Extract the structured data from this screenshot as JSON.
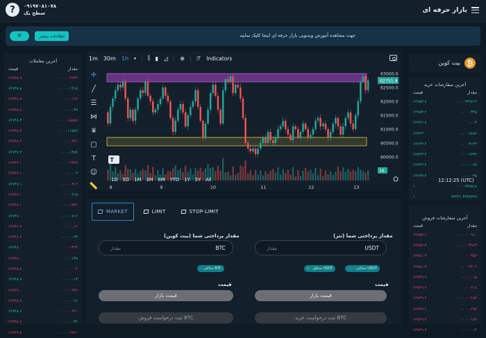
{
  "header": {
    "brand": "بازار حرفه ای",
    "phone": "۰۹۱۹۷۰۸۱۰۷۸",
    "level": "سطح یک",
    "help_glyph": "?"
  },
  "banner": {
    "text": "جهت مشاهده آموزش ویدیویی بازار حرفه ای اینجا کلیک نمایید",
    "more_label": "اطلاعات بیشتر",
    "close_glyph": "✕"
  },
  "ticker": {
    "name": "بیت کوین",
    "symbol_glyph": "₿"
  },
  "colors": {
    "accent": "#13c4c0",
    "buy": "#21c47a",
    "sell": "#e0455b",
    "bg": "#0e1a24",
    "panel": "#131f2b"
  },
  "chart_toolbar": {
    "intervals": [
      "1m",
      "30m",
      "1h"
    ],
    "active_interval": "1h",
    "indicators_label": "Indicators"
  },
  "chart_data": {
    "type": "candlestick",
    "x_ticks": [
      "8",
      "9",
      "10",
      "11",
      "12",
      "13"
    ],
    "y_ticks": [
      "63000.0",
      "62500.0",
      "62000.0",
      "61500.0",
      "61000.0",
      "60500.0",
      "60000.0"
    ],
    "ylim": [
      59700,
      63100
    ],
    "last_price": "62751.9",
    "volume_label": "16",
    "close_series": [
      61600,
      61200,
      61800,
      62100,
      62400,
      62600,
      62500,
      62700,
      62100,
      61400,
      61700,
      61300,
      61700,
      62100,
      62400,
      62300,
      62700,
      62200,
      62000,
      61600,
      61700,
      61900,
      62100,
      62500,
      62200,
      62000,
      61400,
      60900,
      61300,
      61700,
      61900,
      61600,
      61100,
      61500,
      61800,
      62000,
      62400,
      61800,
      61300,
      60700,
      61200,
      61700,
      62300,
      62600,
      62200,
      61700,
      61200,
      62400,
      62800,
      62700,
      62900,
      62300,
      62600,
      62500,
      62100,
      61400,
      60500,
      60300,
      60200,
      60300,
      60100,
      60300,
      60500,
      60700,
      60500,
      60900,
      60600,
      60500,
      60700,
      61000,
      61100,
      61300,
      61000,
      60800,
      60600,
      61100,
      61000,
      60700,
      60900,
      61200,
      61000,
      60700,
      60800,
      61000,
      61300,
      61400,
      61100,
      61200,
      61000,
      60700,
      60900,
      61200,
      61400,
      61100,
      60800,
      61100,
      61400,
      61600,
      61200,
      61000,
      61500,
      62000,
      62700,
      62900,
      62400,
      62751.9
    ],
    "zones": [
      {
        "name": "resistance",
        "low": 62700,
        "high": 63000
      },
      {
        "name": "support",
        "low": 60400,
        "high": 60700
      }
    ]
  },
  "ranges": [
    "1D",
    "5D",
    "1M",
    "3M",
    "6M",
    "YTD",
    "1Y",
    "5Y",
    "All"
  ],
  "clock": "12:12:25 (UTC)",
  "trades": {
    "title": "آخرین معاملات",
    "col_amount": "مقدار",
    "col_price": "قیمت",
    "rows": [
      {
        "amount": "۰.۰۰۰۰۴۲۳۲",
        "price": "۶۲۷۴۸.۹",
        "side": "sell"
      },
      {
        "amount": "۰.۰۰۰۰۱۴۱۸",
        "price": "۶۲۷۴۸.۸",
        "side": "buy"
      },
      {
        "amount": "۰.۰۰۰۱۶۷",
        "price": "۶۲۷۴۸.۷",
        "side": "buy"
      },
      {
        "amount": "۰.۰۰۰۰۳۹",
        "price": "۶۲۷۴۸.۶",
        "side": "buy"
      },
      {
        "amount": "۰.۰۰۰۱۵۸۸۷",
        "price": "۶۲۷۴۸.۳",
        "side": "buy"
      },
      {
        "amount": "۰.۰۰۰۱۱۵۸۹",
        "price": "۶۲۷۴۸.۳",
        "side": "buy"
      },
      {
        "amount": "۰.۰۰۰۴۳۱",
        "price": "۶۲۷۴۸.۲",
        "side": "buy"
      },
      {
        "amount": "۰.۰۰۰۱۴۵۹",
        "price": "۶۲۷۴۷.۳",
        "side": "buy"
      },
      {
        "amount": "۰.۰۰۰۰۶۳۷۹",
        "price": "۶۲۷۴۷.۱",
        "side": "buy"
      },
      {
        "amount": "۰.۰۰۰۳",
        "price": "۶۲۷۴۷.۱",
        "side": "buy"
      },
      {
        "amount": "۰.۰۰۰۰۳۱۲",
        "price": "۶۲۷۴۷.۱",
        "side": "buy"
      },
      {
        "amount": "۰.۰۰۰۲۱۵",
        "price": "۶۲۷۴۷.۱",
        "side": "buy"
      },
      {
        "amount": "۰.۰۰۰۰۱۳۴۲",
        "price": "۶۲۷۴۷.۱",
        "side": "buy"
      },
      {
        "amount": "۰.۰۰۰۰۷۱۲",
        "price": "۶۲۷۴۷.۰",
        "side": "buy"
      },
      {
        "amount": "۰.۰۰۰۰۱۴",
        "price": "۶۲۷۴۶.۹",
        "side": "buy"
      },
      {
        "amount": "۰.۰۰۰۰۰۹۴",
        "price": "۶۲۷۴۶.۶",
        "side": "buy"
      },
      {
        "amount": "۰.۰۰۰۱۳۲۳",
        "price": "۶۲۷۴۸.۰",
        "side": "buy"
      },
      {
        "amount": "۰.۰۰۰۱۳۸",
        "price": "۶۲۷۴۸.۰",
        "side": "buy"
      },
      {
        "amount": "۰.۰۰۰۴",
        "price": "۶۲۷۴۸.۸",
        "side": "buy"
      },
      {
        "amount": "۰.۰۰۰۰۱۳",
        "price": "۶۲۷۴۸.۹",
        "side": "buy"
      },
      {
        "amount": "۰.۰۰۰۰۲۴۲",
        "price": "۶۲۷۴۹.۰",
        "side": "buy"
      },
      {
        "amount": "۰.۰۰۰۰۱۲",
        "price": "۶۲۷۴۸.۹",
        "side": "buy"
      },
      {
        "amount": "۰.۰۰۰۰۳۲۱",
        "price": "۶۲۷۴۸.۶",
        "side": "buy"
      },
      {
        "amount": "۰.۰۰۰۰۳۲",
        "price": "۶۲۷۴۸.۶",
        "side": "buy"
      },
      {
        "amount": "۰.۰۰۰۰۲۳۲۱",
        "price": "۶۲۷۴۹.۹",
        "side": "buy"
      }
    ]
  },
  "buy_orders": {
    "title": "آخرین سفارشات خرید",
    "col_amount": "مقدار",
    "col_price": "قیمت",
    "rows": [
      {
        "amount": "۰.۰۰۲۳۹۷۱۴",
        "price": "۶۲۷۵۳.۸"
      },
      {
        "amount": "۰.۰۰۰۰۳۴۵",
        "price": "۶۲۷۵۳.۲"
      },
      {
        "amount": "۰.۰۰۴",
        "price": "۶۲۷۴۶.۸"
      },
      {
        "amount": "۰.۰۰۰۹۸۸۲",
        "price": "۶۲۷۴۳"
      },
      {
        "amount": "۰.۰۰۰۳۶۴۳",
        "price": "۶۲۷۴۳.۴"
      },
      {
        "amount": "۰.۰۰۰۶۴۳۲",
        "price": "۶۲۷۴۳.۴"
      },
      {
        "amount": "۰.۰۰۰۰۰۲۸",
        "price": "۶۲۷۴۳.۴"
      },
      {
        "amount": "۰.۰۰۰۰۳۵",
        "price": "۶۲۷۴۳.۴"
      },
      {
        "amount": "۰.۰۰۹۳۷۵۱۸",
        "price": "۱"
      },
      {
        "amount": "۹۳۴۳۱.۳۹۳۸۳۲۸",
        "price": "۱"
      },
      {
        "amount": "۹۳۴۳۱.۳۹۳۸۳۲۸",
        "price": "۱"
      }
    ]
  },
  "sell_orders": {
    "title": "آخرین سفارشات فروش",
    "col_amount": "مقدار",
    "col_price": "قیمت",
    "rows": [
      {
        "amount": "۰.۰۰۰۰۰۹۶۰",
        "price": "۶۲۷۵۳.۶"
      },
      {
        "amount": "۰.۰۰۰۰۳۹۶۳",
        "price": "۶۲۷۵۲.۳"
      },
      {
        "amount": "۰.۰۰۰۰۳۵۲",
        "price": "۶۲۷۵۱.۳"
      },
      {
        "amount": "۰.۰۰۰۳۳۰۲",
        "price": "۶۲۷۵۱.۳"
      },
      {
        "amount": "۰.۰۰۰۰۰۱۵",
        "price": "۶۲۷۴۹.۹"
      },
      {
        "amount": "۰.۰۰۰۲۱۸",
        "price": "۶۲۷۴۹.۹"
      },
      {
        "amount": "۰.۰۰۰۰۰۴۸۳",
        "price": "۶۲۷۴۹.۴"
      },
      {
        "amount": "۰.۰۰۰۰۲۹۶",
        "price": "۶۲۷۴۹.۶"
      },
      {
        "amount": "۰.۰۰۰۰۱۵۹",
        "price": "۶۲۷۴۹.۴"
      },
      {
        "amount": "۰.۰۰۰۰۰۱۳",
        "price": "۶۲۷۴۹.۳"
      }
    ]
  },
  "trade_tabs": {
    "market": "MARKET",
    "limit": "LIMIT",
    "stop_limit": "STOP-LIMIT"
  },
  "sell_form": {
    "amount_label": "مقدار پرداختی شما (بیت کوین)",
    "currency": "BTC",
    "placeholder": "مقدار",
    "max_pill": "حداکثر: ۰ BTC",
    "price_label": "قیمت",
    "price_button": "قیمت بازار",
    "submit": "ثبت درخواست فروش BTC"
  },
  "buy_form": {
    "amount_label": "مقدار پرداختی شما (تتر)",
    "currency": "USDT",
    "placeholder": "مقدار",
    "max_pill": "حداکثر: ۰.۰۰ USDT",
    "min_pill": "حداقل: ۱۰ USDT",
    "price_label": "قیمت",
    "price_button": "قیمت بازار",
    "submit": "ثبت درخواست خرید BTC"
  }
}
